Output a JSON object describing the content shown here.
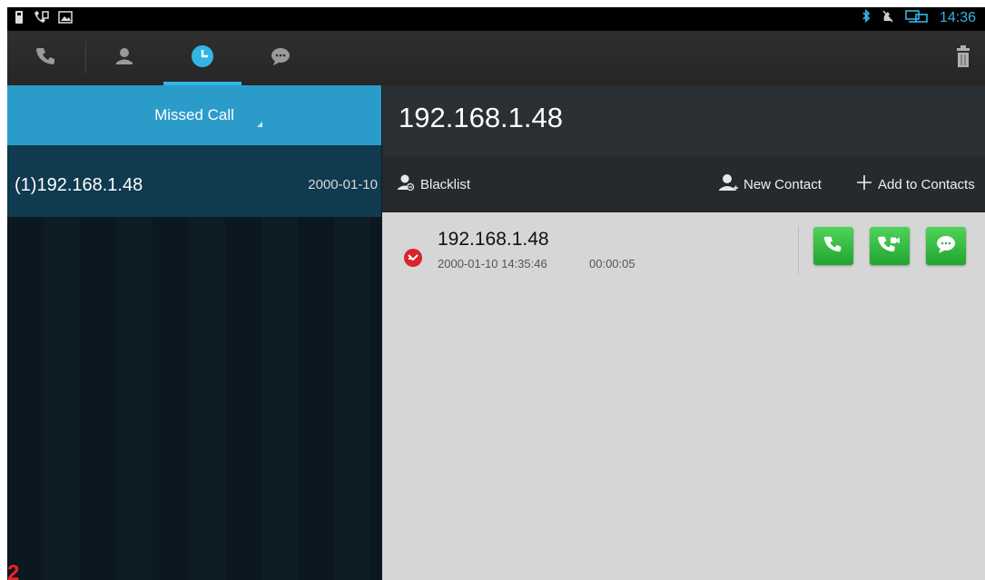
{
  "status_bar": {
    "left_icons": [
      "usb-icon",
      "call-status-icon",
      "image-icon"
    ],
    "right_icons": [
      "bluetooth-icon",
      "mute-icon",
      "network-icon"
    ],
    "time": "14:36"
  },
  "tabs": [
    {
      "name": "dialer",
      "icon": "phone-icon",
      "active": false
    },
    {
      "name": "contacts",
      "icon": "contact-icon",
      "active": false
    },
    {
      "name": "call-history",
      "icon": "clock-icon",
      "active": true
    },
    {
      "name": "messages",
      "icon": "message-icon",
      "active": false
    }
  ],
  "filter": {
    "label": "Missed Call"
  },
  "log": {
    "items": [
      {
        "number": "(1)192.168.1.48",
        "date": "2000-01-10"
      }
    ]
  },
  "detail": {
    "title": "192.168.1.48",
    "actions": {
      "blacklist": "Blacklist",
      "new_contact": "New Contact",
      "add_to_contacts": "Add to Contacts"
    },
    "entry": {
      "number": "192.168.1.48",
      "datetime": "2000-01-10 14:35:46",
      "duration": "00:00:05"
    }
  },
  "page_number": "2",
  "colors": {
    "accent": "#33b5e5",
    "filter_bg": "#2b9cc9",
    "selected_row": "#0f3a4f",
    "missed": "#d8242a",
    "call_button": "#2fb83b"
  }
}
